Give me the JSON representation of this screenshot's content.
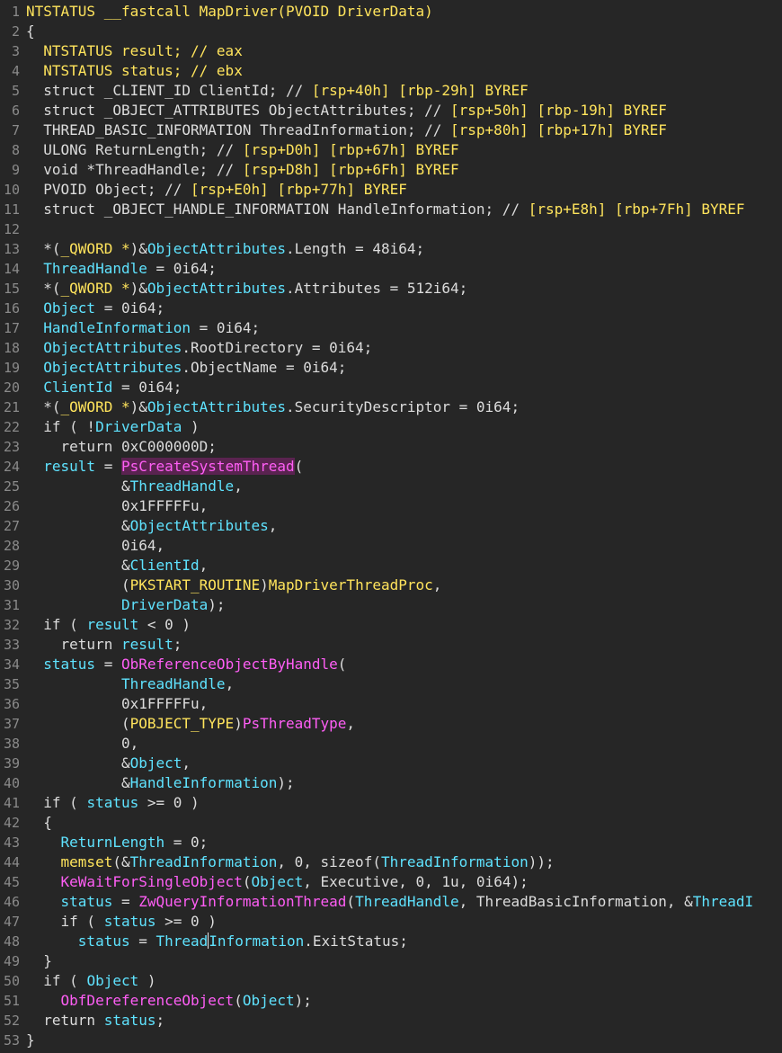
{
  "colors": {
    "background": "#262626",
    "plain": "#dcdcdc",
    "type": "#ffe45c",
    "variable": "#5fe3ff",
    "function": "#ff5ef5",
    "comment": "#5fe3ff",
    "highlight_background": "#5a2350"
  },
  "code_lines": [
    {
      "n": "1",
      "tokens": [
        {
          "t": "NTSTATUS __fastcall MapDriver(PVOID DriverData)",
          "k": "type"
        }
      ]
    },
    {
      "n": "2",
      "tokens": [
        {
          "t": "{",
          "k": "plain"
        }
      ]
    },
    {
      "n": "3",
      "tokens": [
        {
          "t": "  NTSTATUS result; // eax",
          "k": "type"
        }
      ]
    },
    {
      "n": "4",
      "tokens": [
        {
          "t": "  NTSTATUS status; // ebx",
          "k": "type"
        }
      ]
    },
    {
      "n": "5",
      "tokens": [
        {
          "t": "  struct _CLIENT_ID ClientId; // ",
          "k": "plain"
        },
        {
          "t": "[rsp+40h] [rbp-29h] BYREF",
          "k": "type"
        }
      ]
    },
    {
      "n": "6",
      "tokens": [
        {
          "t": "  struct _OBJECT_ATTRIBUTES ObjectAttributes; // ",
          "k": "plain"
        },
        {
          "t": "[rsp+50h] [rbp-19h] BYREF",
          "k": "type"
        }
      ]
    },
    {
      "n": "7",
      "tokens": [
        {
          "t": "  THREAD_BASIC_INFORMATION ThreadInformation; // ",
          "k": "plain"
        },
        {
          "t": "[rsp+80h] [rbp+17h] BYREF",
          "k": "type"
        }
      ]
    },
    {
      "n": "8",
      "tokens": [
        {
          "t": "  ULONG ReturnLength; // ",
          "k": "plain"
        },
        {
          "t": "[rsp+D0h] [rbp+67h] BYREF",
          "k": "type"
        }
      ]
    },
    {
      "n": "9",
      "tokens": [
        {
          "t": "  void *ThreadHandle; // ",
          "k": "plain"
        },
        {
          "t": "[rsp+D8h] [rbp+6Fh] BYREF",
          "k": "type"
        }
      ]
    },
    {
      "n": "10",
      "tokens": [
        {
          "t": "  PVOID Object; // ",
          "k": "plain"
        },
        {
          "t": "[rsp+E0h] [rbp+77h] BYREF",
          "k": "type"
        }
      ]
    },
    {
      "n": "11",
      "tokens": [
        {
          "t": "  struct _OBJECT_HANDLE_INFORMATION HandleInformation; // ",
          "k": "plain"
        },
        {
          "t": "[rsp+E8h] [rbp+7Fh] BYREF",
          "k": "type"
        }
      ]
    },
    {
      "n": "12",
      "tokens": []
    },
    {
      "n": "13",
      "tokens": [
        {
          "t": "  *(",
          "k": "plain"
        },
        {
          "t": "_QWORD *",
          "k": "type"
        },
        {
          "t": ")&",
          "k": "plain"
        },
        {
          "t": "ObjectAttributes",
          "k": "var"
        },
        {
          "t": ".Length = 48i64;",
          "k": "plain"
        }
      ]
    },
    {
      "n": "14",
      "tokens": [
        {
          "t": "  ",
          "k": "plain"
        },
        {
          "t": "ThreadHandle",
          "k": "var"
        },
        {
          "t": " = 0i64;",
          "k": "plain"
        }
      ]
    },
    {
      "n": "15",
      "tokens": [
        {
          "t": "  *(",
          "k": "plain"
        },
        {
          "t": "_QWORD *",
          "k": "type"
        },
        {
          "t": ")&",
          "k": "plain"
        },
        {
          "t": "ObjectAttributes",
          "k": "var"
        },
        {
          "t": ".Attributes = 512i64;",
          "k": "plain"
        }
      ]
    },
    {
      "n": "16",
      "tokens": [
        {
          "t": "  ",
          "k": "plain"
        },
        {
          "t": "Object",
          "k": "var"
        },
        {
          "t": " = 0i64;",
          "k": "plain"
        }
      ]
    },
    {
      "n": "17",
      "tokens": [
        {
          "t": "  ",
          "k": "plain"
        },
        {
          "t": "HandleInformation",
          "k": "var"
        },
        {
          "t": " = 0i64;",
          "k": "plain"
        }
      ]
    },
    {
      "n": "18",
      "tokens": [
        {
          "t": "  ",
          "k": "plain"
        },
        {
          "t": "ObjectAttributes",
          "k": "var"
        },
        {
          "t": ".RootDirectory = 0i64;",
          "k": "plain"
        }
      ]
    },
    {
      "n": "19",
      "tokens": [
        {
          "t": "  ",
          "k": "plain"
        },
        {
          "t": "ObjectAttributes",
          "k": "var"
        },
        {
          "t": ".ObjectName = 0i64;",
          "k": "plain"
        }
      ]
    },
    {
      "n": "20",
      "tokens": [
        {
          "t": "  ",
          "k": "plain"
        },
        {
          "t": "ClientId",
          "k": "var"
        },
        {
          "t": " = 0i64;",
          "k": "plain"
        }
      ]
    },
    {
      "n": "21",
      "tokens": [
        {
          "t": "  *(",
          "k": "plain"
        },
        {
          "t": "_OWORD *",
          "k": "type"
        },
        {
          "t": ")&",
          "k": "plain"
        },
        {
          "t": "ObjectAttributes",
          "k": "var"
        },
        {
          "t": ".SecurityDescriptor = 0i64;",
          "k": "plain"
        }
      ]
    },
    {
      "n": "22",
      "tokens": [
        {
          "t": "  if ( !",
          "k": "plain"
        },
        {
          "t": "DriverData",
          "k": "var"
        },
        {
          "t": " )",
          "k": "plain"
        }
      ]
    },
    {
      "n": "23",
      "tokens": [
        {
          "t": "    return 0xC000000D;",
          "k": "plain"
        }
      ]
    },
    {
      "n": "24",
      "tokens": [
        {
          "t": "  ",
          "k": "plain"
        },
        {
          "t": "result",
          "k": "var"
        },
        {
          "t": " = ",
          "k": "plain"
        },
        {
          "t": "PsCreateSystemThread",
          "k": "func",
          "hl": true
        },
        {
          "t": "(",
          "k": "plain"
        }
      ]
    },
    {
      "n": "25",
      "tokens": [
        {
          "t": "           &",
          "k": "plain"
        },
        {
          "t": "ThreadHandle",
          "k": "var"
        },
        {
          "t": ",",
          "k": "plain"
        }
      ]
    },
    {
      "n": "26",
      "tokens": [
        {
          "t": "           0x1FFFFFu,",
          "k": "plain"
        }
      ]
    },
    {
      "n": "27",
      "tokens": [
        {
          "t": "           &",
          "k": "plain"
        },
        {
          "t": "ObjectAttributes",
          "k": "var"
        },
        {
          "t": ",",
          "k": "plain"
        }
      ]
    },
    {
      "n": "28",
      "tokens": [
        {
          "t": "           0i64,",
          "k": "plain"
        }
      ]
    },
    {
      "n": "29",
      "tokens": [
        {
          "t": "           &",
          "k": "plain"
        },
        {
          "t": "ClientId",
          "k": "var"
        },
        {
          "t": ",",
          "k": "plain"
        }
      ]
    },
    {
      "n": "30",
      "tokens": [
        {
          "t": "           (",
          "k": "plain"
        },
        {
          "t": "PKSTART_ROUTINE",
          "k": "type"
        },
        {
          "t": ")",
          "k": "plain"
        },
        {
          "t": "MapDriverThreadProc",
          "k": "type"
        },
        {
          "t": ",",
          "k": "plain"
        }
      ]
    },
    {
      "n": "31",
      "tokens": [
        {
          "t": "           ",
          "k": "plain"
        },
        {
          "t": "DriverData",
          "k": "var"
        },
        {
          "t": ");",
          "k": "plain"
        }
      ]
    },
    {
      "n": "32",
      "tokens": [
        {
          "t": "  if ( ",
          "k": "plain"
        },
        {
          "t": "result",
          "k": "var"
        },
        {
          "t": " < 0 )",
          "k": "plain"
        }
      ]
    },
    {
      "n": "33",
      "tokens": [
        {
          "t": "    return ",
          "k": "plain"
        },
        {
          "t": "result",
          "k": "var"
        },
        {
          "t": ";",
          "k": "plain"
        }
      ]
    },
    {
      "n": "34",
      "tokens": [
        {
          "t": "  ",
          "k": "plain"
        },
        {
          "t": "status",
          "k": "var"
        },
        {
          "t": " = ",
          "k": "plain"
        },
        {
          "t": "ObReferenceObjectByHandle",
          "k": "func"
        },
        {
          "t": "(",
          "k": "plain"
        }
      ]
    },
    {
      "n": "35",
      "tokens": [
        {
          "t": "           ",
          "k": "plain"
        },
        {
          "t": "ThreadHandle",
          "k": "var"
        },
        {
          "t": ",",
          "k": "plain"
        }
      ]
    },
    {
      "n": "36",
      "tokens": [
        {
          "t": "           0x1FFFFFu,",
          "k": "plain"
        }
      ]
    },
    {
      "n": "37",
      "tokens": [
        {
          "t": "           (",
          "k": "plain"
        },
        {
          "t": "POBJECT_TYPE",
          "k": "type"
        },
        {
          "t": ")",
          "k": "plain"
        },
        {
          "t": "PsThreadType",
          "k": "func"
        },
        {
          "t": ",",
          "k": "plain"
        }
      ]
    },
    {
      "n": "38",
      "tokens": [
        {
          "t": "           0,",
          "k": "plain"
        }
      ]
    },
    {
      "n": "39",
      "tokens": [
        {
          "t": "           &",
          "k": "plain"
        },
        {
          "t": "Object",
          "k": "var"
        },
        {
          "t": ",",
          "k": "plain"
        }
      ]
    },
    {
      "n": "40",
      "tokens": [
        {
          "t": "           &",
          "k": "plain"
        },
        {
          "t": "HandleInformation",
          "k": "var"
        },
        {
          "t": ");",
          "k": "plain"
        }
      ]
    },
    {
      "n": "41",
      "tokens": [
        {
          "t": "  if ( ",
          "k": "plain"
        },
        {
          "t": "status",
          "k": "var"
        },
        {
          "t": " >= 0 )",
          "k": "plain"
        }
      ]
    },
    {
      "n": "42",
      "tokens": [
        {
          "t": "  {",
          "k": "plain"
        }
      ]
    },
    {
      "n": "43",
      "tokens": [
        {
          "t": "    ",
          "k": "plain"
        },
        {
          "t": "ReturnLength",
          "k": "var"
        },
        {
          "t": " = 0;",
          "k": "plain"
        }
      ]
    },
    {
      "n": "44",
      "tokens": [
        {
          "t": "    ",
          "k": "plain"
        },
        {
          "t": "memset",
          "k": "type"
        },
        {
          "t": "(&",
          "k": "plain"
        },
        {
          "t": "ThreadInformation",
          "k": "var"
        },
        {
          "t": ", 0, sizeof(",
          "k": "plain"
        },
        {
          "t": "ThreadInformation",
          "k": "var"
        },
        {
          "t": "));",
          "k": "plain"
        }
      ]
    },
    {
      "n": "45",
      "tokens": [
        {
          "t": "    ",
          "k": "plain"
        },
        {
          "t": "KeWaitForSingleObject",
          "k": "func"
        },
        {
          "t": "(",
          "k": "plain"
        },
        {
          "t": "Object",
          "k": "var"
        },
        {
          "t": ", Executive, 0, 1u, 0i64);",
          "k": "plain"
        }
      ]
    },
    {
      "n": "46",
      "tokens": [
        {
          "t": "    ",
          "k": "plain"
        },
        {
          "t": "status",
          "k": "var"
        },
        {
          "t": " = ",
          "k": "plain"
        },
        {
          "t": "ZwQueryInformationThread",
          "k": "func"
        },
        {
          "t": "(",
          "k": "plain"
        },
        {
          "t": "ThreadHandle",
          "k": "var"
        },
        {
          "t": ", ThreadBasicInformation, &",
          "k": "plain"
        },
        {
          "t": "ThreadI",
          "k": "var"
        }
      ]
    },
    {
      "n": "47",
      "tokens": [
        {
          "t": "    if ( ",
          "k": "plain"
        },
        {
          "t": "status",
          "k": "var"
        },
        {
          "t": " >= 0 )",
          "k": "plain"
        }
      ]
    },
    {
      "n": "48",
      "tokens": [
        {
          "t": "      ",
          "k": "plain"
        },
        {
          "t": "status",
          "k": "var"
        },
        {
          "t": " = ",
          "k": "plain"
        },
        {
          "t": "Thread",
          "k": "var",
          "caret_after": true
        },
        {
          "t": "Information",
          "k": "var"
        },
        {
          "t": ".ExitStatus;",
          "k": "plain"
        }
      ]
    },
    {
      "n": "49",
      "tokens": [
        {
          "t": "  }",
          "k": "plain"
        }
      ]
    },
    {
      "n": "50",
      "tokens": [
        {
          "t": "  if ( ",
          "k": "plain"
        },
        {
          "t": "Object",
          "k": "var"
        },
        {
          "t": " )",
          "k": "plain"
        }
      ]
    },
    {
      "n": "51",
      "tokens": [
        {
          "t": "    ",
          "k": "plain"
        },
        {
          "t": "ObfDereferenceObject",
          "k": "func"
        },
        {
          "t": "(",
          "k": "plain"
        },
        {
          "t": "Object",
          "k": "var"
        },
        {
          "t": ");",
          "k": "plain"
        }
      ]
    },
    {
      "n": "52",
      "tokens": [
        {
          "t": "  return ",
          "k": "plain"
        },
        {
          "t": "status",
          "k": "var"
        },
        {
          "t": ";",
          "k": "plain"
        }
      ]
    },
    {
      "n": "53",
      "tokens": [
        {
          "t": "}",
          "k": "plain"
        }
      ]
    }
  ]
}
